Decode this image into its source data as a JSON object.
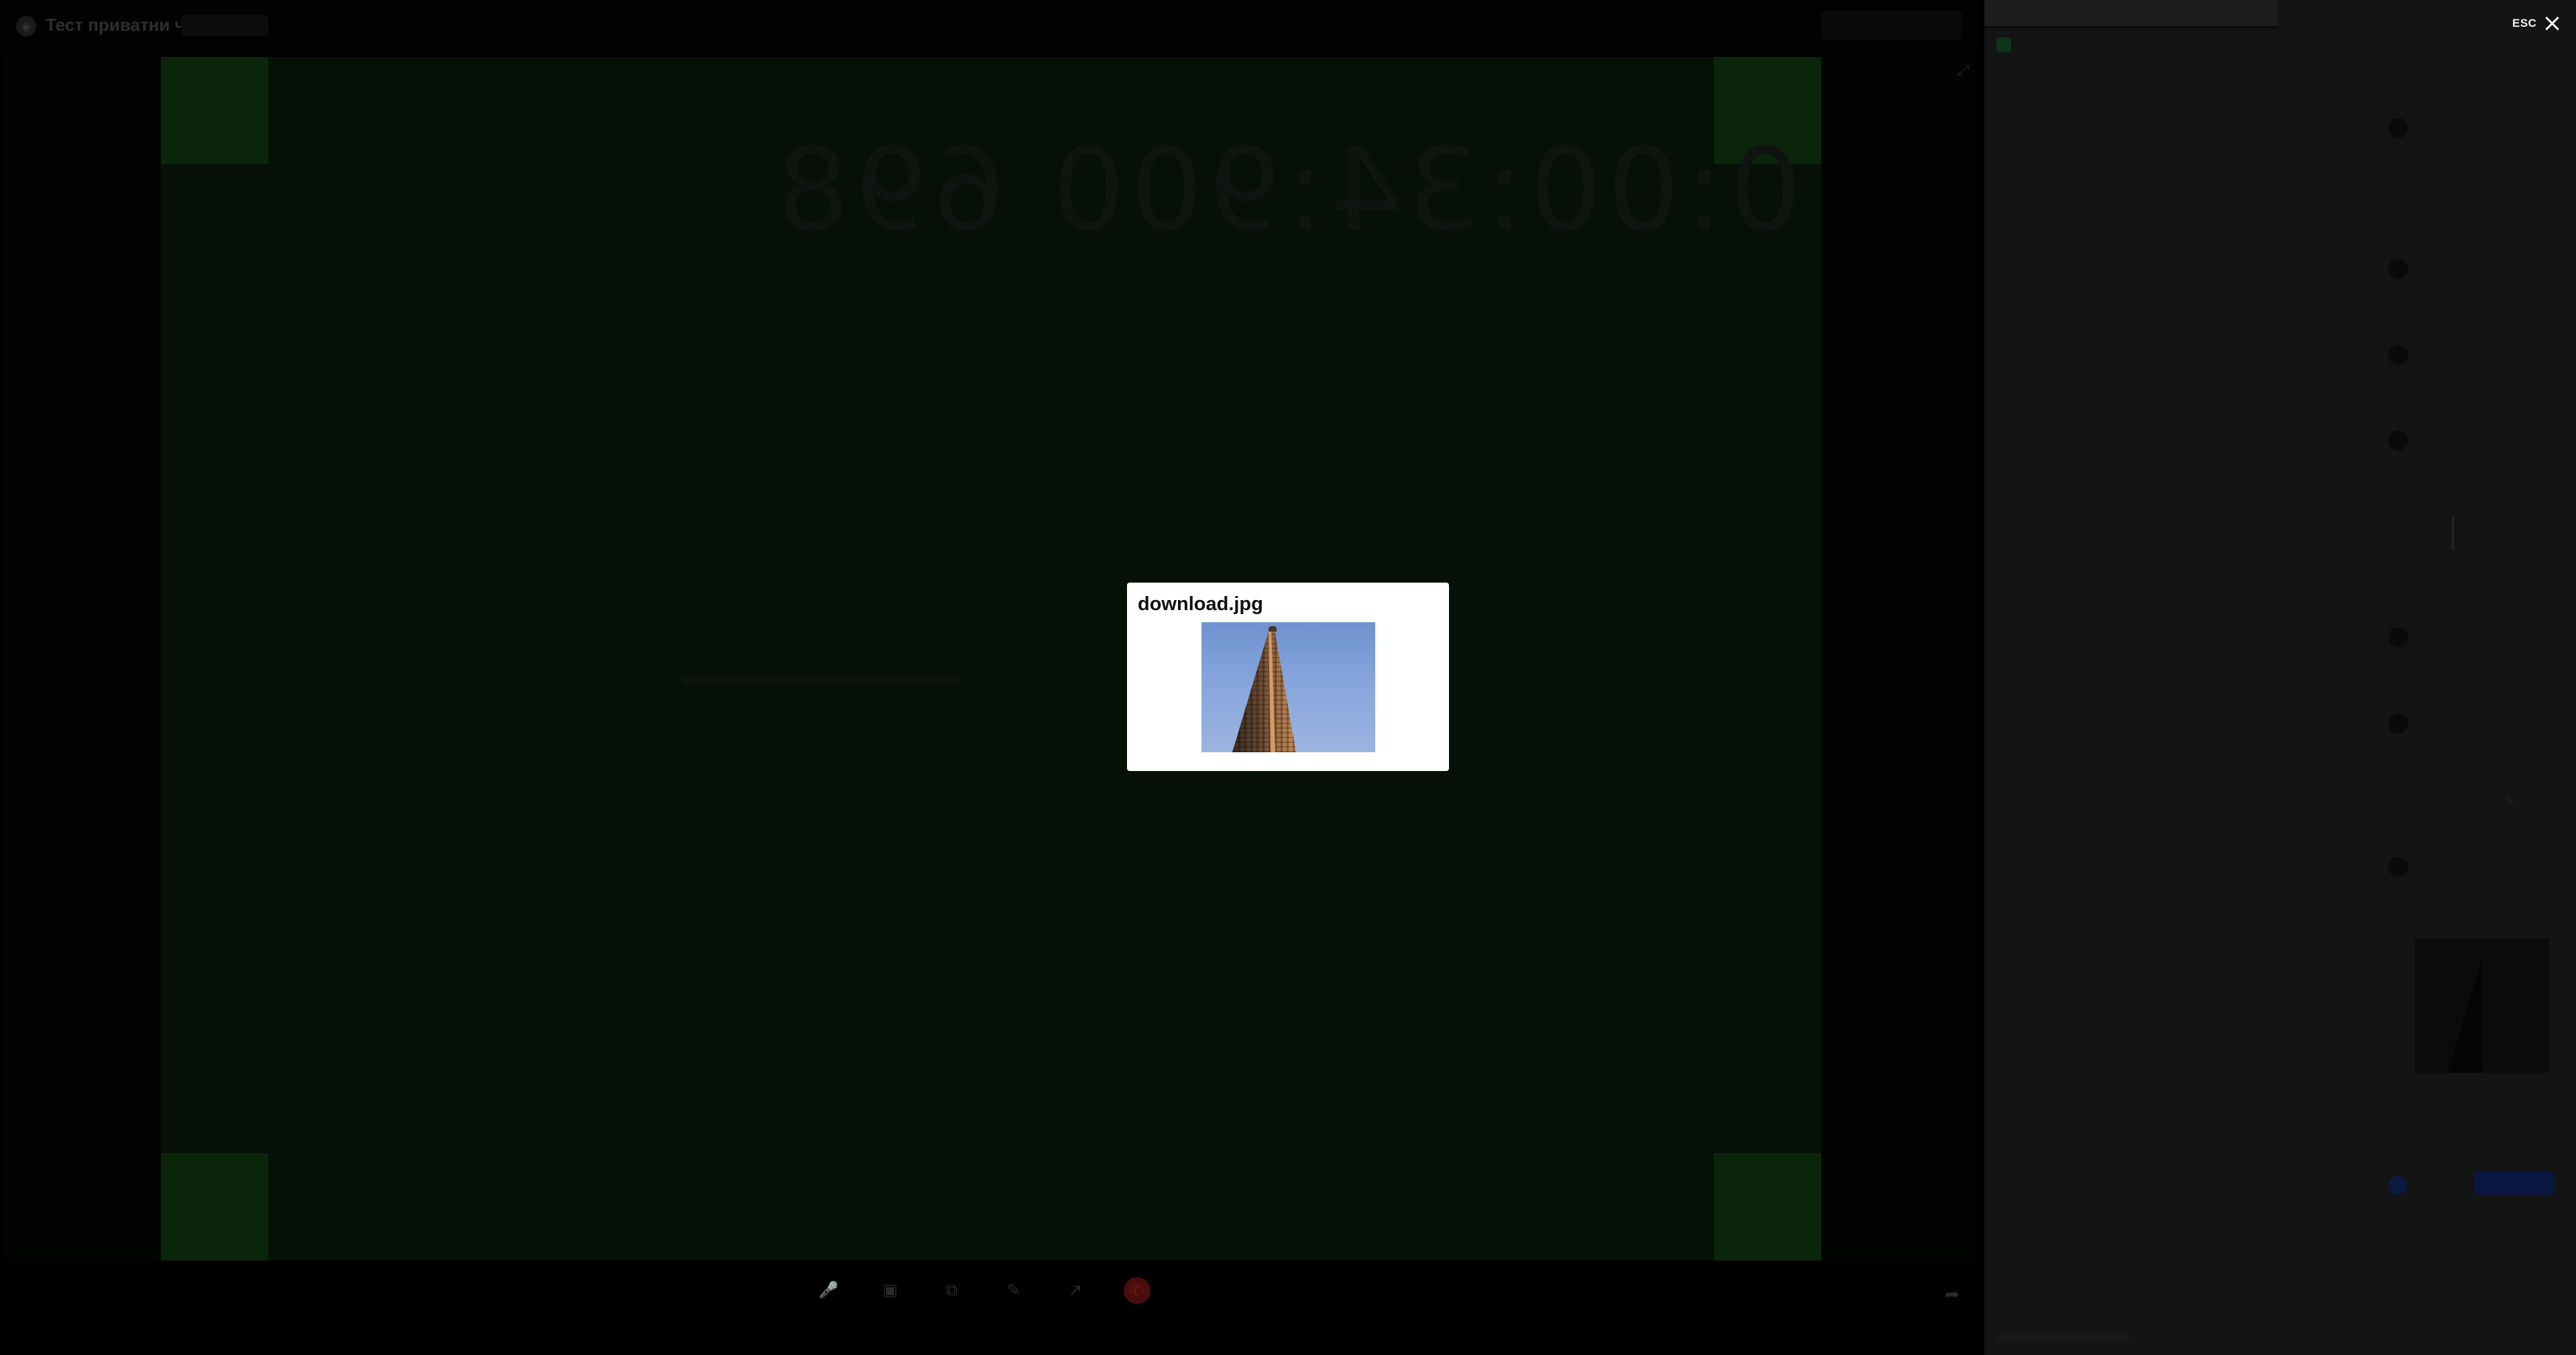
{
  "app": {
    "title": "Тест приватни чат",
    "title_badge": "",
    "top_button": ""
  },
  "stage": {
    "timer": "0:00:34:900 698",
    "label": ""
  },
  "controls": [
    {
      "name": "mic-button",
      "icon": "🎤",
      "label": ""
    },
    {
      "name": "camera-button",
      "icon": "▣",
      "label": ""
    },
    {
      "name": "screen-share-button",
      "icon": "⧉",
      "label": ""
    },
    {
      "name": "effects-button",
      "icon": "✎",
      "label": ""
    },
    {
      "name": "reactions-button",
      "icon": "↗",
      "label": ""
    },
    {
      "name": "end-call-button",
      "icon": "✆",
      "label": ""
    }
  ],
  "panel": {
    "tabs": [
      "",
      ""
    ],
    "header": "",
    "date_separator": "",
    "messages": [
      {
        "who": "",
        "time": ""
      },
      {
        "who": "",
        "time": ""
      },
      {
        "who": "",
        "time": ""
      },
      {
        "who": "",
        "time": ""
      },
      {
        "who": "",
        "time": ""
      },
      {
        "who": "",
        "time": ""
      },
      {
        "who": "",
        "time": ""
      }
    ],
    "own_label": "",
    "composer_placeholder": ""
  },
  "close": {
    "label": "ESC",
    "icon": "close-icon"
  },
  "modal": {
    "title": "download.jpg",
    "image_alt": "download.jpg"
  }
}
